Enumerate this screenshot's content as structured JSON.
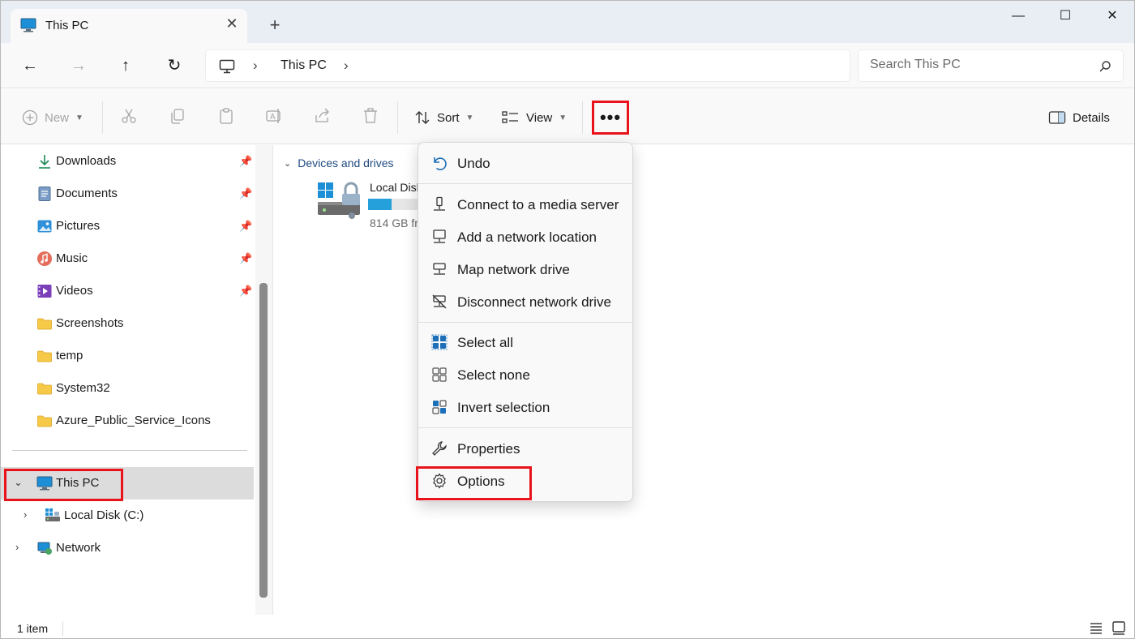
{
  "window": {
    "tab_title": "This PC",
    "new_tab_glyph": "+",
    "close_tab_glyph": "✕",
    "controls": {
      "minimize": "—",
      "maximize": "☐",
      "close": "✕"
    }
  },
  "navigation": {
    "back_glyph": "←",
    "forward_glyph": "→",
    "up_glyph": "↑",
    "refresh_glyph": "↻",
    "breadcrumb": [
      "This PC"
    ],
    "breadcrumb_sep": "›",
    "search_placeholder": "Search This PC"
  },
  "commandbar": {
    "new_label": "New",
    "sort_label": "Sort",
    "view_label": "View",
    "more_glyph": "•••",
    "details_label": "Details",
    "icons": [
      "cut-icon",
      "copy-icon",
      "paste-icon",
      "rename-icon",
      "share-icon",
      "delete-icon"
    ]
  },
  "sidebar": {
    "quick_access": [
      {
        "label": "Downloads",
        "icon": "downloads-icon",
        "pinned": true
      },
      {
        "label": "Documents",
        "icon": "documents-icon",
        "pinned": true
      },
      {
        "label": "Pictures",
        "icon": "pictures-icon",
        "pinned": true
      },
      {
        "label": "Music",
        "icon": "music-icon",
        "pinned": true
      },
      {
        "label": "Videos",
        "icon": "videos-icon",
        "pinned": true
      },
      {
        "label": "Screenshots",
        "icon": "folder-icon",
        "pinned": false
      },
      {
        "label": "temp",
        "icon": "folder-icon",
        "pinned": false
      },
      {
        "label": "System32",
        "icon": "folder-icon",
        "pinned": false
      },
      {
        "label": "Azure_Public_Service_Icons",
        "icon": "folder-icon",
        "pinned": false
      }
    ],
    "this_pc": "This PC",
    "local_disk": "Local Disk (C:)",
    "network": "Network"
  },
  "content": {
    "group_header": "Devices and drives",
    "drive_name": "Local Disk",
    "drive_free": "814 GB fr",
    "drive_used_fraction": 0.21
  },
  "menu": {
    "undo": "Undo",
    "connect_media": "Connect to a media server",
    "add_network_location": "Add a network location",
    "map_network_drive": "Map network drive",
    "disconnect_network_drive": "Disconnect network drive",
    "select_all": "Select all",
    "select_none": "Select none",
    "invert_selection": "Invert selection",
    "properties": "Properties",
    "options": "Options"
  },
  "status": {
    "item_count": "1 item"
  },
  "colors": {
    "highlight_red": "#e8131b",
    "accent_blue": "#26a0da",
    "folder_yellow": "#f7c948"
  }
}
